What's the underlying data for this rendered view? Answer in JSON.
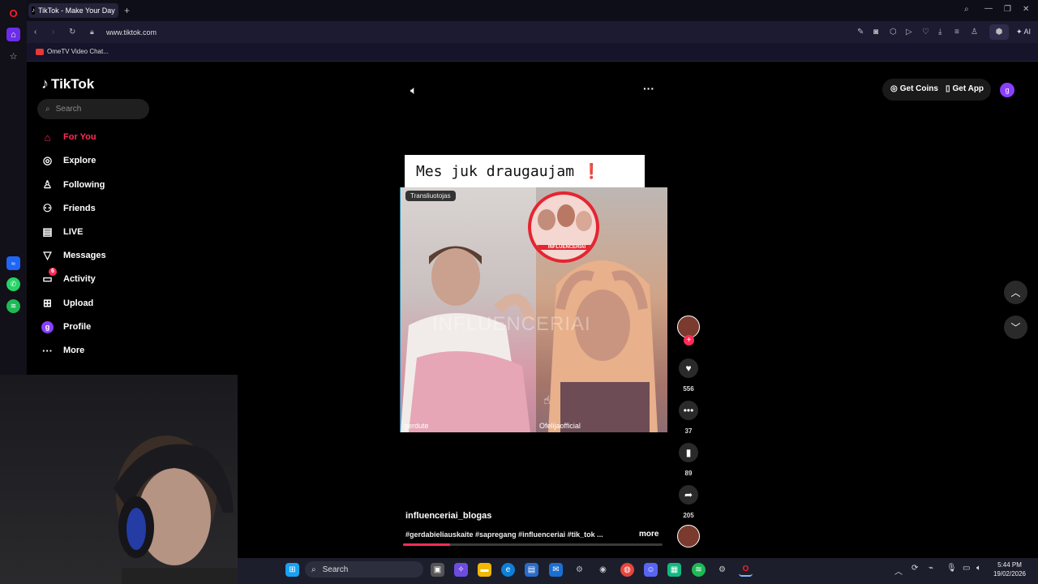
{
  "browser": {
    "tab_title": "TikTok - Make Your Day",
    "url": "www.tiktok.com",
    "bookmark": "OmeTV Video Chat...",
    "ai_label": "AI"
  },
  "tiktok": {
    "logo": "TikTok",
    "search_placeholder": "Search",
    "nav": [
      {
        "label": "For You",
        "icon": "home-icon"
      },
      {
        "label": "Explore",
        "icon": "compass-icon"
      },
      {
        "label": "Following",
        "icon": "user-icon"
      },
      {
        "label": "Friends",
        "icon": "friends-icon"
      },
      {
        "label": "LIVE",
        "icon": "live-icon"
      },
      {
        "label": "Messages",
        "icon": "send-icon"
      },
      {
        "label": "Activity",
        "icon": "inbox-icon"
      },
      {
        "label": "Upload",
        "icon": "plus-icon"
      },
      {
        "label": "Profile",
        "icon": "avatar"
      },
      {
        "label": "More",
        "icon": "more-icon"
      }
    ],
    "activity_badge": "6",
    "profile_initial": "g",
    "get_coins": "Get Coins",
    "get_app": "Get App",
    "user_initial": "g"
  },
  "video": {
    "caption": "Mes juk draugaujam",
    "live_tag": "Transliuotojas",
    "left_user": "gerdute",
    "right_user": "Ofelijaofficial",
    "watermark": "INFLUENCERIAI",
    "sticker_label": "INFLUENCERIAI",
    "author": "influenceriai_blogas",
    "hashtags": "#gerdabieliauskaite #sapregang  #influenceriai #tik_tok ...",
    "more": "more",
    "likes": "556",
    "comments": "37",
    "saves": "89",
    "shares": "205"
  },
  "taskbar": {
    "search": "Search",
    "time": "5:44 PM",
    "date": "19/02/2026"
  },
  "colors": {
    "accent": "#fe2c55",
    "opera_red": "#ff1b2d",
    "opera_purple": "#8a3ffc",
    "taskbar": "#1d1e2c"
  }
}
